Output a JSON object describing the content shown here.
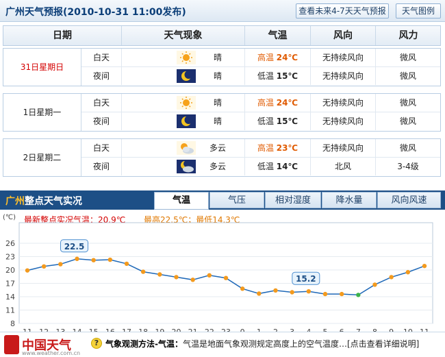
{
  "header": {
    "title": "广州天气预报(2010-10-31  11:00发布)",
    "btn_week": "查看未来4-7天天气预报",
    "btn_legend": "天气图例"
  },
  "table": {
    "columns": [
      "日期",
      "天气现象",
      "气温",
      "风向",
      "风力"
    ],
    "days": [
      {
        "date": "31日星期日",
        "highlight": true,
        "rows": [
          {
            "period": "白天",
            "icon": "sun-icon",
            "weather": "晴",
            "temp_label": "高温",
            "temp": "24℃",
            "wind_dir": "无持续风向",
            "wind_force": "微风"
          },
          {
            "period": "夜间",
            "icon": "moon-icon",
            "weather": "晴",
            "temp_label": "低温",
            "temp": "15℃",
            "wind_dir": "无持续风向",
            "wind_force": "微风"
          }
        ]
      },
      {
        "date": "1日星期一",
        "highlight": false,
        "rows": [
          {
            "period": "白天",
            "icon": "sun-icon",
            "weather": "晴",
            "temp_label": "高温",
            "temp": "24℃",
            "wind_dir": "无持续风向",
            "wind_force": "微风"
          },
          {
            "period": "夜间",
            "icon": "moon-icon",
            "weather": "晴",
            "temp_label": "低温",
            "temp": "15℃",
            "wind_dir": "无持续风向",
            "wind_force": "微风"
          }
        ]
      },
      {
        "date": "2日星期二",
        "highlight": false,
        "rows": [
          {
            "period": "白天",
            "icon": "sun-cloud-icon",
            "weather": "多云",
            "temp_label": "高温",
            "temp": "23℃",
            "wind_dir": "无持续风向",
            "wind_force": "微风"
          },
          {
            "period": "夜间",
            "icon": "moon-cloud-icon",
            "weather": "多云",
            "temp_label": "低温",
            "temp": "14℃",
            "wind_dir": "北风",
            "wind_force": "3-4级"
          }
        ]
      }
    ]
  },
  "observation": {
    "city": "广州",
    "title": "整点天气实况",
    "tabs": [
      "气温",
      "气压",
      "相对湿度",
      "降水量",
      "风向风速"
    ],
    "active_tab": 0,
    "latest": "最新整点实况气温：20.9℃",
    "range": "最高22.5℃；最低14.3℃"
  },
  "chart_data": {
    "type": "line",
    "ylabel": "(℃)",
    "yticks": [
      8,
      11,
      14,
      17,
      20,
      23,
      26
    ],
    "ylim": [
      8,
      26
    ],
    "categories": [
      "11",
      "12",
      "13",
      "14",
      "15",
      "16",
      "17",
      "18",
      "19",
      "20",
      "21",
      "22",
      "23",
      "0",
      "1",
      "2",
      "3",
      "4",
      "5",
      "6",
      "7",
      "8",
      "9",
      "10",
      "11"
    ],
    "values": [
      19.9,
      20.8,
      21.3,
      22.5,
      22.2,
      22.3,
      21.4,
      19.6,
      19.0,
      18.4,
      17.8,
      18.8,
      18.2,
      15.8,
      14.7,
      15.4,
      15.0,
      15.2,
      14.6,
      14.6,
      14.4,
      16.7,
      18.4,
      19.5,
      20.9
    ],
    "max_label": "22.5",
    "min_label": "15.2",
    "line_color": "#1e68b8",
    "point_color": "#f39a1e",
    "grid": true
  },
  "footer": {
    "logo": "中国天气",
    "url": "www.weather.com.cn",
    "note_bold": "气象观测方法-气温：",
    "note_text": "气温是地面气象观测规定高度上的空气温度…[点击查看详细说明]"
  }
}
